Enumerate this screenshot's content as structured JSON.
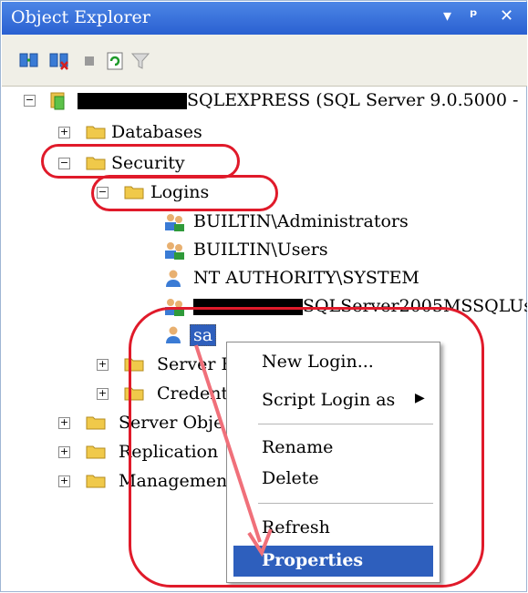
{
  "window": {
    "title": "Object Explorer",
    "pin_glyph": "▾ ╤",
    "close_glyph": "✕"
  },
  "toolbar": {
    "buttons": [
      "connect-icon",
      "disconnect-icon",
      "stop-icon",
      "refresh-icon",
      "filter-icon"
    ]
  },
  "tree": {
    "server_suffix": "SQLEXPRESS (SQL Server 9.0.5000 -",
    "databases": "Databases",
    "security": "Security",
    "logins": "Logins",
    "login_items": [
      "BUILTIN\\Administrators",
      "BUILTIN\\Users",
      "NT AUTHORITY\\SYSTEM",
      "SQLServer2005MSSQLUs",
      "sa"
    ],
    "server_roles": "Server R",
    "credentials": "Credent",
    "server_objects": "Server Obje",
    "replication": "Replication",
    "management": "Managemen"
  },
  "context_menu": {
    "items": [
      "New Login...",
      "Script Login as",
      "Rename",
      "Delete",
      "Refresh",
      "Properties"
    ],
    "submenu_arrow": "▶"
  },
  "colors": {
    "title_bar": "#2a60d1",
    "highlight": "#2e5fbd",
    "annotation": "#e01a2a"
  }
}
